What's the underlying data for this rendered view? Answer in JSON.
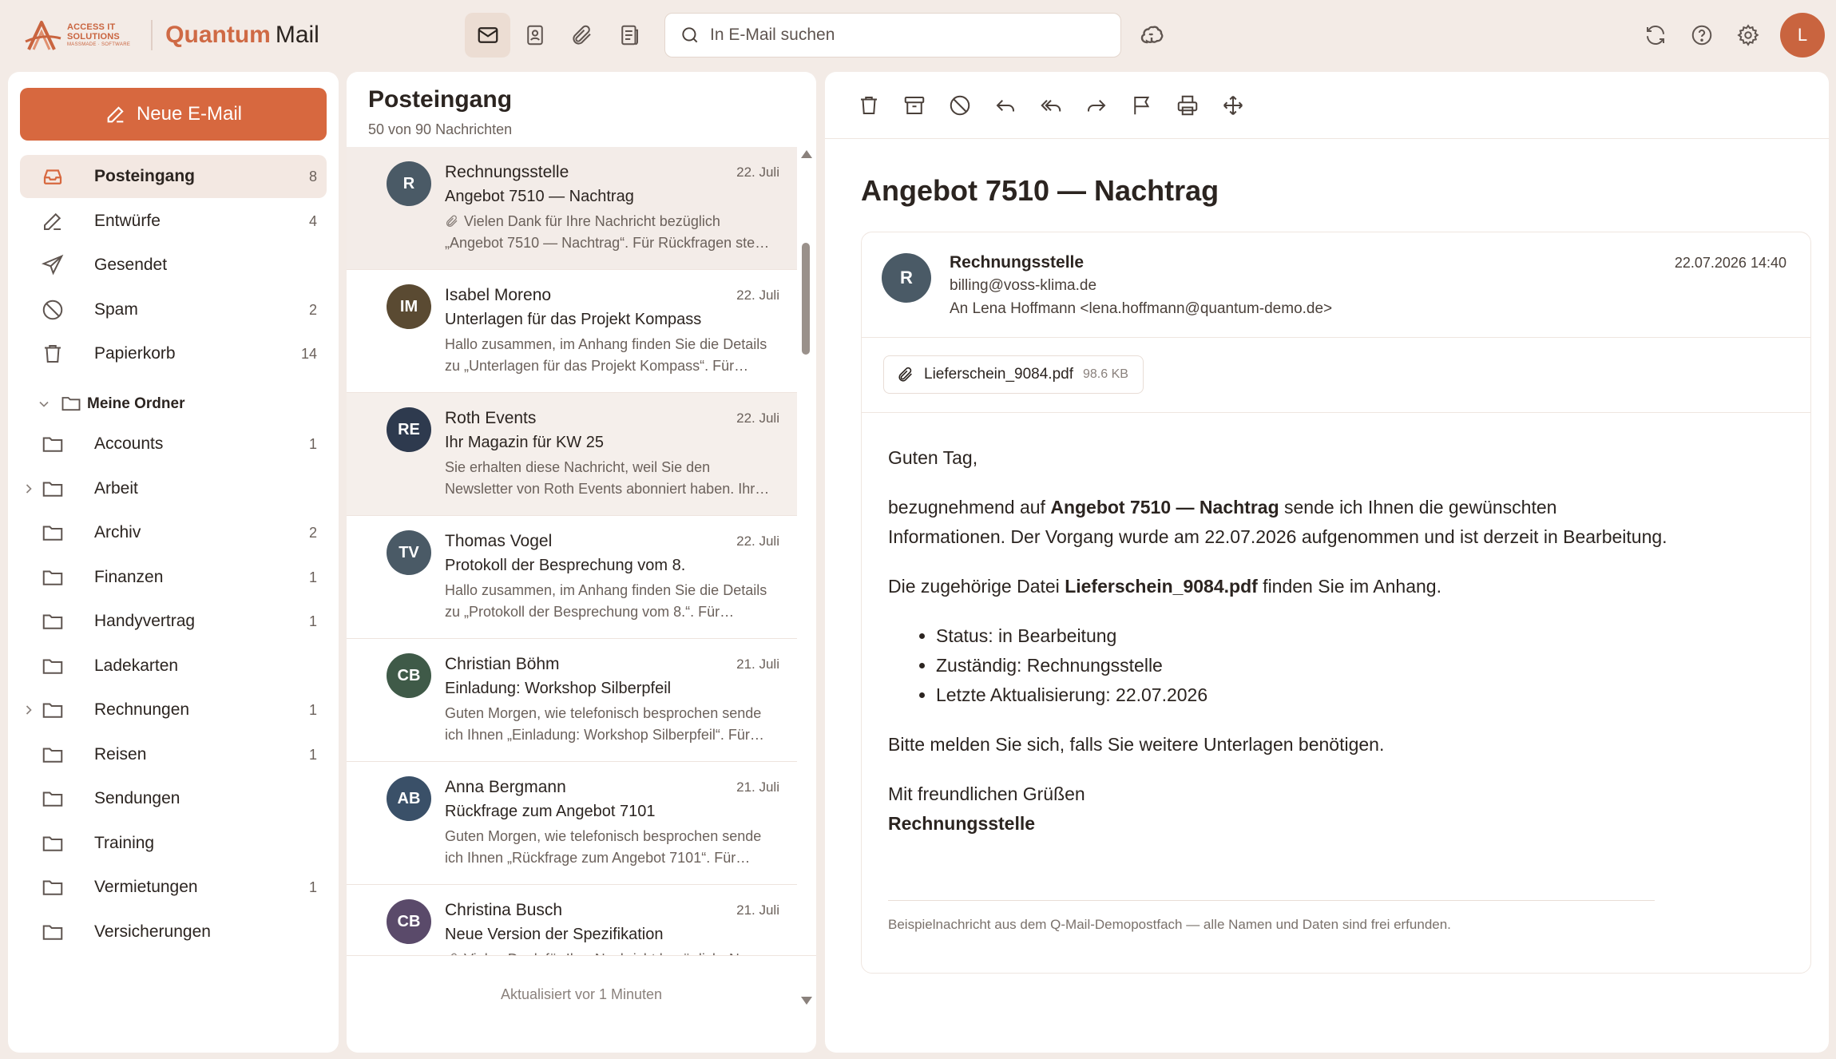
{
  "app": {
    "brand_line1": "ACCESS IT",
    "brand_line2": "SOLUTIONS",
    "brand_line3": "MASSMADE · SOFTWARE",
    "name_bold": "Quantum",
    "name_regular": "Mail",
    "accent_color": "#d7683f"
  },
  "nav": {
    "items": [
      {
        "icon": "mail-icon",
        "active": true
      },
      {
        "icon": "contacts-icon",
        "active": false
      },
      {
        "icon": "paperclip-icon",
        "active": false
      },
      {
        "icon": "notes-icon",
        "active": false
      }
    ]
  },
  "search": {
    "placeholder": "In E-Mail suchen",
    "value": ""
  },
  "user": {
    "initial": "L"
  },
  "sidebar": {
    "compose_label": "Neue E-Mail",
    "folders": [
      {
        "label": "Posteingang",
        "count": "8",
        "icon": "inbox-icon",
        "active": true
      },
      {
        "label": "Entwürfe",
        "count": "4",
        "icon": "pencil-icon"
      },
      {
        "label": "Gesendet",
        "count": "",
        "icon": "send-icon"
      },
      {
        "label": "Spam",
        "count": "2",
        "icon": "spam-icon"
      },
      {
        "label": "Papierkorb",
        "count": "14",
        "icon": "trash-icon"
      }
    ],
    "group_label": "Meine Ordner",
    "custom_folders": [
      {
        "label": "Accounts",
        "count": "1",
        "expandable": false
      },
      {
        "label": "Arbeit",
        "count": "",
        "expandable": true
      },
      {
        "label": "Archiv",
        "count": "2",
        "expandable": false
      },
      {
        "label": "Finanzen",
        "count": "1",
        "expandable": false
      },
      {
        "label": "Handyvertrag",
        "count": "1",
        "expandable": false
      },
      {
        "label": "Ladekarten",
        "count": "",
        "expandable": false
      },
      {
        "label": "Rechnungen",
        "count": "1",
        "expandable": true
      },
      {
        "label": "Reisen",
        "count": "1",
        "expandable": false
      },
      {
        "label": "Sendungen",
        "count": "",
        "expandable": false
      },
      {
        "label": "Training",
        "count": "",
        "expandable": false
      },
      {
        "label": "Vermietungen",
        "count": "1",
        "expandable": false
      },
      {
        "label": "Versicherungen",
        "count": "",
        "expandable": false
      }
    ]
  },
  "list": {
    "title": "Posteingang",
    "subtitle": "50 von 90 Nachrichten",
    "footer": "Aktualisiert vor 1 Minuten",
    "messages": [
      {
        "initials": "R",
        "color": "#4a5a66",
        "from": "Rechnungsstelle",
        "date": "22. Juli",
        "subject": "Angebot 7510 — Nachtrag",
        "attachment": true,
        "preview": "Vielen Dank für Ihre Nachricht bezüglich „Angebot 7510 — Nachtrag“. Für Rückfragen ste…",
        "selected": true
      },
      {
        "initials": "IM",
        "color": "#5a4a32",
        "from": "Isabel Moreno",
        "date": "22. Juli",
        "subject": "Unterlagen für das Projekt Kompass",
        "attachment": false,
        "preview": "Hallo zusammen, im Anhang finden Sie die Details zu „Unterlagen für das Projekt Kompass“. Für…"
      },
      {
        "initials": "RE",
        "color": "#2e3a4e",
        "from": "Roth Events",
        "date": "22. Juli",
        "subject": "Ihr Magazin für KW 25",
        "attachment": false,
        "preview": "Sie erhalten diese Nachricht, weil Sie den Newsletter von Roth Events abonniert haben. Ihr…",
        "hover": true
      },
      {
        "initials": "TV",
        "color": "#4a5a66",
        "from": "Thomas Vogel",
        "date": "22. Juli",
        "subject": "Protokoll der Besprechung vom 8.",
        "attachment": false,
        "preview": "Hallo zusammen, im Anhang finden Sie die Details zu „Protokoll der Besprechung vom 8.“. Für…"
      },
      {
        "initials": "CB",
        "color": "#3f5a48",
        "from": "Christian Böhm",
        "date": "21. Juli",
        "subject": "Einladung: Workshop Silberpfeil",
        "attachment": false,
        "preview": "Guten Morgen, wie telefonisch besprochen sende ich Ihnen „Einladung: Workshop Silberpfeil“. Für…"
      },
      {
        "initials": "AB",
        "color": "#3a5068",
        "from": "Anna Bergmann",
        "date": "21. Juli",
        "subject": "Rückfrage zum Angebot 7101",
        "attachment": false,
        "preview": "Guten Morgen, wie telefonisch besprochen sende ich Ihnen „Rückfrage zum Angebot 7101“. Für…"
      },
      {
        "initials": "CB",
        "color": "#5a4a6a",
        "from": "Christina Busch",
        "date": "21. Juli",
        "subject": "Neue Version der Spezifikation",
        "attachment": true,
        "preview": "Vielen Dank für Ihre Nachricht bezüglich „Neue Version der Spezifikation“. Für Rückfragen stehe…"
      }
    ]
  },
  "reader": {
    "toolbar": [
      "delete-icon",
      "archive-icon",
      "block-icon",
      "reply-icon",
      "reply-all-icon",
      "forward-icon",
      "flag-icon",
      "print-icon",
      "move-icon"
    ],
    "subject": "Angebot 7510 — Nachtrag",
    "sender_initial": "R",
    "sender_name": "Rechnungsstelle",
    "sender_email": "billing@voss-klima.de",
    "recipient": "An Lena Hoffmann <lena.hoffmann@quantum-demo.de>",
    "datetime": "22.07.2026 14:40",
    "attachment": {
      "name": "Lieferschein_9084.pdf",
      "size": "98.6 KB"
    },
    "body": {
      "greeting": "Guten Tag,",
      "p1_pre": "bezugnehmend auf ",
      "p1_bold": "Angebot 7510 — Nachtrag",
      "p1_post": " sende ich Ihnen die gewünschten Informationen. Der Vorgang wurde am 22.07.2026 aufgenommen und ist derzeit in Bearbeitung.",
      "p2_pre": "Die zugehörige Datei ",
      "p2_bold": "Lieferschein_9084.pdf",
      "p2_post": " finden Sie im Anhang.",
      "bullets": [
        "Status: in Bearbeitung",
        "Zuständig: Rechnungsstelle",
        "Letzte Aktualisierung: 22.07.2026"
      ],
      "p3": "Bitte melden Sie sich, falls Sie weitere Unterlagen benötigen.",
      "closing": "Mit freundlichen Grüßen",
      "signature": "Rechnungsstelle"
    },
    "footnote": "Beispielnachricht aus dem Q-Mail-Demopostfach — alle Namen und Daten sind frei erfunden."
  }
}
